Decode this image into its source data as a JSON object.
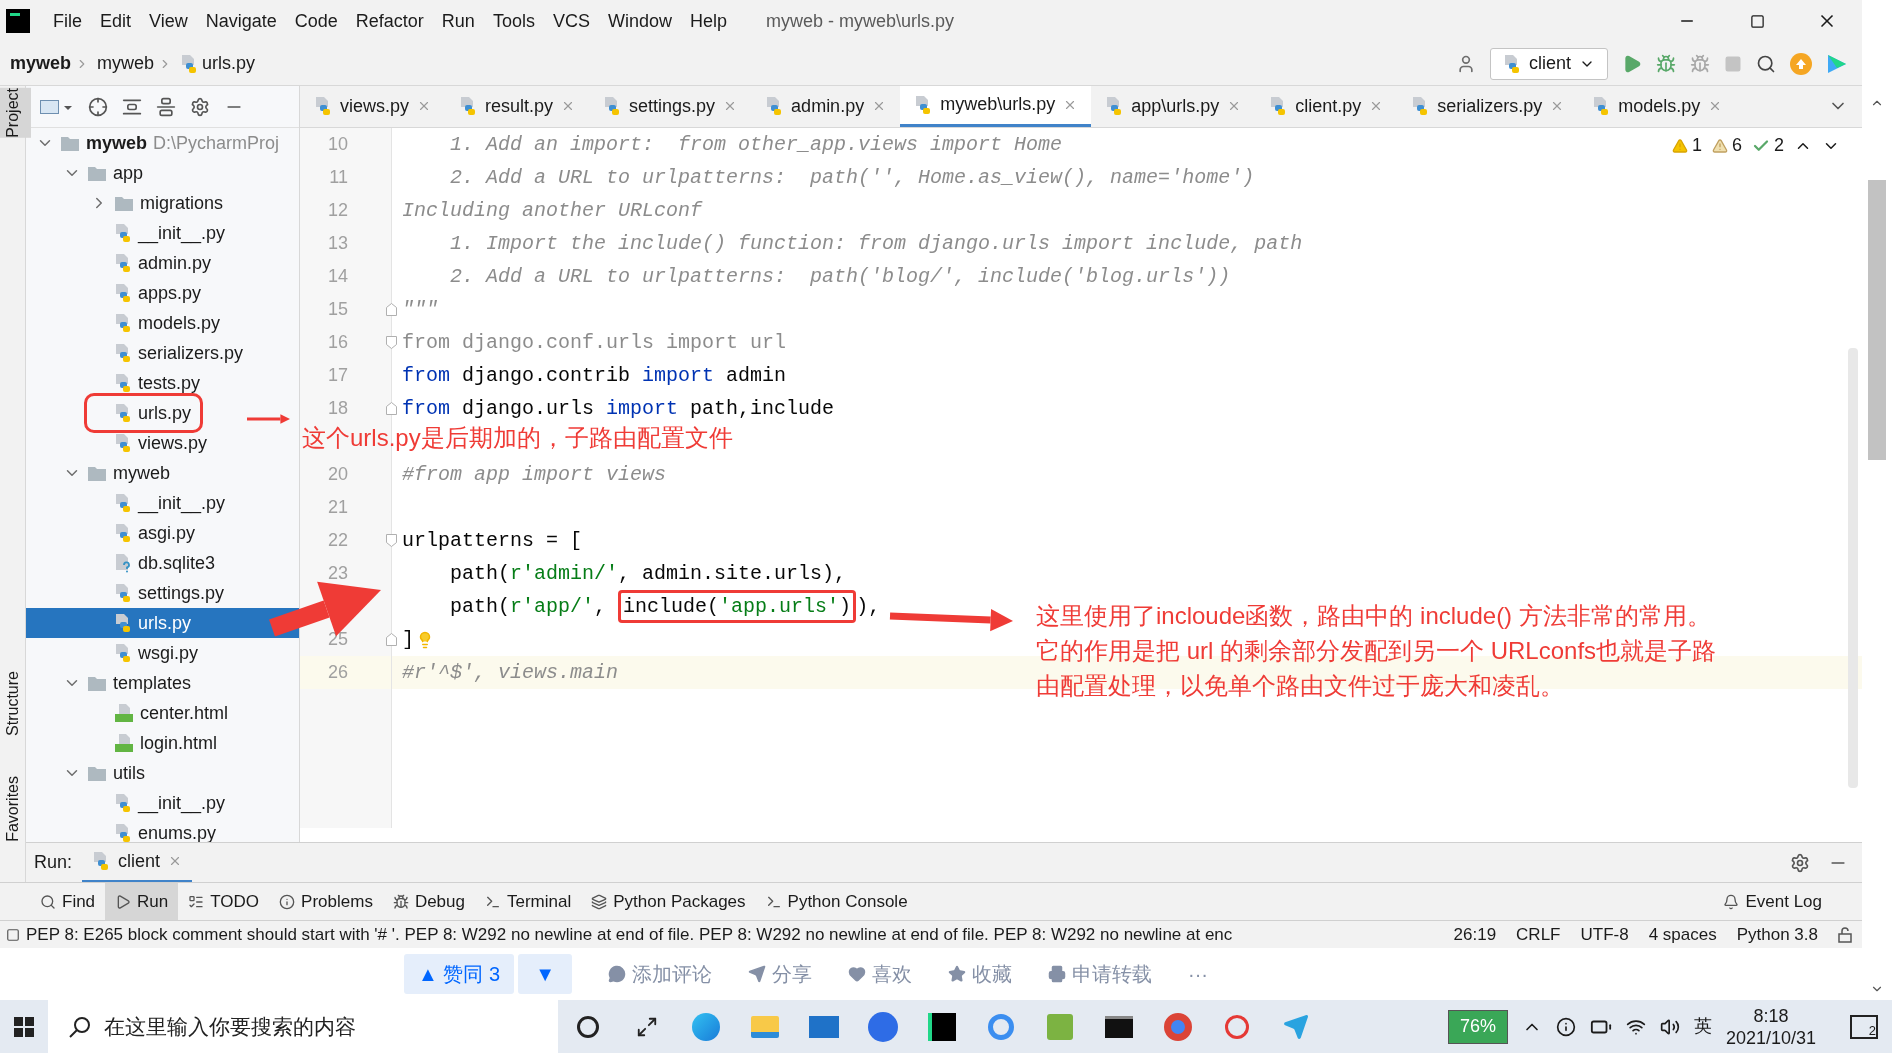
{
  "window": {
    "title": "myweb - myweb\\urls.py",
    "menu": [
      "File",
      "Edit",
      "View",
      "Navigate",
      "Code",
      "Refactor",
      "Run",
      "Tools",
      "VCS",
      "Window",
      "Help"
    ]
  },
  "breadcrumb": [
    "myweb",
    "myweb",
    "urls.py"
  ],
  "run_config": "client",
  "side_tabs": [
    {
      "label": "Project",
      "selected": true
    },
    {
      "label": "Structure",
      "selected": false
    },
    {
      "label": "Favorites",
      "selected": false
    }
  ],
  "tree": [
    {
      "label": "myweb",
      "path": "D:\\PycharmProj",
      "kind": "folder",
      "expanded": true,
      "selected": false,
      "children": [
        {
          "label": "app",
          "kind": "folder",
          "expanded": true,
          "selected": false,
          "children": [
            {
              "label": "migrations",
              "kind": "folder",
              "expanded": false,
              "selected": false
            },
            {
              "label": "__init__.py",
              "kind": "python",
              "selected": false
            },
            {
              "label": "admin.py",
              "kind": "python",
              "selected": false
            },
            {
              "label": "apps.py",
              "kind": "python",
              "selected": false
            },
            {
              "label": "models.py",
              "kind": "python",
              "selected": false
            },
            {
              "label": "serializers.py",
              "kind": "python",
              "selected": false
            },
            {
              "label": "tests.py",
              "kind": "python",
              "selected": false
            },
            {
              "label": "urls.py",
              "kind": "python",
              "selected": false,
              "annotated": true
            },
            {
              "label": "views.py",
              "kind": "python",
              "selected": false
            }
          ]
        },
        {
          "label": "myweb",
          "kind": "folder",
          "expanded": true,
          "selected": false,
          "children": [
            {
              "label": "__init__.py",
              "kind": "python",
              "selected": false
            },
            {
              "label": "asgi.py",
              "kind": "python",
              "selected": false
            },
            {
              "label": "db.sqlite3",
              "kind": "unknown",
              "selected": false
            },
            {
              "label": "settings.py",
              "kind": "python",
              "selected": false
            },
            {
              "label": "urls.py",
              "kind": "python",
              "selected": true
            },
            {
              "label": "wsgi.py",
              "kind": "python",
              "selected": false
            }
          ]
        },
        {
          "label": "templates",
          "kind": "folder",
          "expanded": true,
          "selected": false,
          "children": [
            {
              "label": "center.html",
              "kind": "html",
              "selected": false
            },
            {
              "label": "login.html",
              "kind": "html",
              "selected": false
            }
          ]
        },
        {
          "label": "utils",
          "kind": "folder",
          "expanded": true,
          "selected": false,
          "children": [
            {
              "label": "__init__.py",
              "kind": "python",
              "selected": false
            },
            {
              "label": "enums.py",
              "kind": "python",
              "selected": false
            }
          ]
        }
      ]
    }
  ],
  "tabs": [
    {
      "label": "views.py",
      "selected": false
    },
    {
      "label": "result.py",
      "selected": false
    },
    {
      "label": "settings.py",
      "selected": false
    },
    {
      "label": "admin.py",
      "selected": false
    },
    {
      "label": "myweb\\urls.py",
      "selected": true
    },
    {
      "label": "app\\urls.py",
      "selected": false
    },
    {
      "label": "client.py",
      "selected": false
    },
    {
      "label": "serializers.py",
      "selected": false
    },
    {
      "label": "models.py",
      "selected": false
    }
  ],
  "inspections": {
    "errors": "1",
    "warnings": "6",
    "ok": "2"
  },
  "code": [
    {
      "number": "10",
      "tokens": [
        {
          "t": "    1. Add an import:  from other_app.views import Home",
          "kind": "docstring"
        }
      ]
    },
    {
      "number": "11",
      "tokens": [
        {
          "t": "    2. Add a URL to urlpatterns:  path('', Home.as_view(), name='home')",
          "kind": "docstring"
        }
      ]
    },
    {
      "number": "12",
      "tokens": [
        {
          "t": "Including another URLconf",
          "kind": "docstring"
        }
      ]
    },
    {
      "number": "13",
      "tokens": [
        {
          "t": "    1. Import the include() function: from django.urls import include, path",
          "kind": "docstring"
        }
      ]
    },
    {
      "number": "14",
      "tokens": [
        {
          "t": "    2. Add a URL to urlpatterns:  path('blog/', include('blog.urls'))",
          "kind": "docstring"
        }
      ]
    },
    {
      "number": "15",
      "fold_end": true,
      "tokens": [
        {
          "t": "\"\"\"",
          "kind": "docstring"
        }
      ]
    },
    {
      "number": "16",
      "fold_start": true,
      "tokens": [
        {
          "t": "from django.conf.urls import url",
          "kind": "unused"
        }
      ]
    },
    {
      "number": "17",
      "tokens": [
        {
          "t": "from",
          "kind": "keyword"
        },
        {
          "t": " django.contrib ",
          "kind": "plain"
        },
        {
          "t": "import",
          "kind": "keyword"
        },
        {
          "t": " admin",
          "kind": "plain"
        }
      ]
    },
    {
      "number": "18",
      "fold_end": true,
      "tokens": [
        {
          "t": "from",
          "kind": "keyword"
        },
        {
          "t": " django.urls ",
          "kind": "plain"
        },
        {
          "t": "import",
          "kind": "keyword"
        },
        {
          "t": " path,include",
          "kind": "plain"
        }
      ]
    },
    {
      "annotation": "这个urls.py是后期加的，子路由配置文件"
    },
    {
      "number": "20",
      "tokens": [
        {
          "t": "#from app import views",
          "kind": "comment"
        }
      ]
    },
    {
      "number": "21"
    },
    {
      "number": "22",
      "fold_start": true,
      "tokens": [
        {
          "t": "urlpatterns = [",
          "kind": "plain"
        }
      ]
    },
    {
      "number": "23",
      "tokens": [
        {
          "t": "    path(",
          "kind": "plain"
        },
        {
          "t": "r'admin/'",
          "kind": "string"
        },
        {
          "t": ", admin.site.urls),",
          "kind": "plain"
        }
      ]
    },
    {
      "tokens": [
        {
          "t": "    path(",
          "kind": "plain"
        },
        {
          "t": "r'app/'",
          "kind": "string"
        },
        {
          "t": ", ",
          "kind": "plain"
        },
        {
          "t": "include(",
          "kind": "plain",
          "annotated": true
        },
        {
          "t": "'app.urls'",
          "kind": "string",
          "annotated": true
        },
        {
          "t": ")",
          "kind": "plain",
          "annotated": true
        },
        {
          "t": "),",
          "kind": "plain"
        }
      ]
    },
    {
      "number": "25",
      "fold_end": true,
      "hint": true,
      "tokens": [
        {
          "t": "]",
          "kind": "plain"
        }
      ]
    },
    {
      "number": "26",
      "current": true,
      "tokens": [
        {
          "t": "#r'^$', views.main",
          "kind": "comment"
        }
      ]
    }
  ],
  "annotations": {
    "code_note": [
      "这里使用了incloude函数，路由中的 include() 方法非常的常用。",
      "它的作用是把 url 的剩余部分发配到另一个 URLconfs也就是子路",
      "由配置处理，以免单个路由文件过于庞大和凌乱。"
    ]
  },
  "run_bar": {
    "label": "Run:",
    "tab": "client"
  },
  "tool_windows": [
    {
      "label": "Find",
      "kind": "find",
      "selected": false
    },
    {
      "label": "Run",
      "kind": "run",
      "selected": true
    },
    {
      "label": "TODO",
      "kind": "todo",
      "selected": false
    },
    {
      "label": "Problems",
      "kind": "problems",
      "selected": false
    },
    {
      "label": "Debug",
      "kind": "debug",
      "selected": false
    },
    {
      "label": "Terminal",
      "kind": "terminal",
      "selected": false
    },
    {
      "label": "Python Packages",
      "kind": "packages",
      "selected": false
    },
    {
      "label": "Python Console",
      "kind": "console",
      "selected": false
    }
  ],
  "event_log": "Event Log",
  "status_bar": {
    "message": "PEP 8: E265 block comment should start with '# '. PEP 8: W292 no newline at end of file. PEP 8: W292 no newline at end of file. PEP 8: W292 no newline at enc",
    "items": [
      "26:19",
      "CRLF",
      "UTF-8",
      "4 spaces",
      "Python 3.8"
    ]
  },
  "page_actions": {
    "upvote": "▲ 赞同 3",
    "downvote": "▼",
    "actions": [
      "添加评论",
      "分享",
      "喜欢",
      "收藏",
      "申请转载"
    ],
    "more": "···"
  },
  "taskbar": {
    "search_placeholder": "在这里输入你要搜索的内容",
    "battery": "76%",
    "ime": "英",
    "time": "8:18",
    "date": "2021/10/31",
    "notifications": "2"
  }
}
